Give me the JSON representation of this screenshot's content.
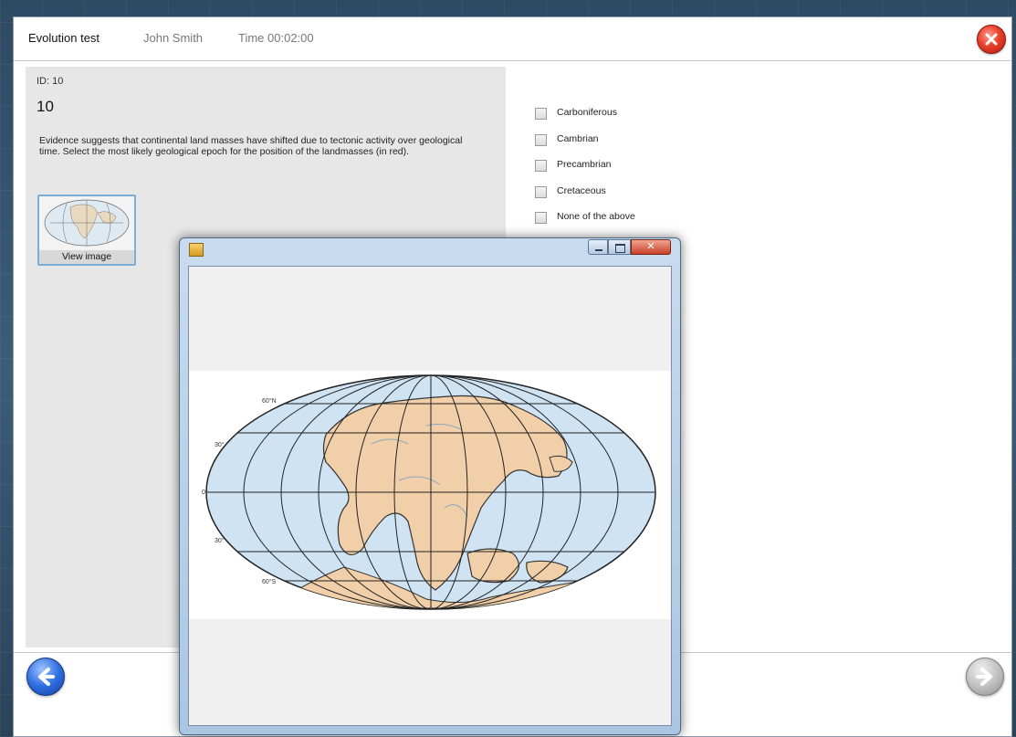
{
  "header": {
    "title": "Evolution  test",
    "user": "John Smith",
    "time": "Time 00:02:00"
  },
  "question": {
    "id_label": "ID: 10",
    "number": "10",
    "text": "Evidence suggests that continental land masses have shifted due to tectonic activity over geological time. Select the most likely geological epoch for the position of the landmasses (in red).",
    "thumbnail_label": "View image"
  },
  "options": [
    {
      "label": "Carboniferous",
      "checked": false
    },
    {
      "label": "Cambrian",
      "checked": false
    },
    {
      "label": "Precambrian",
      "checked": false
    },
    {
      "label": "Cretaceous",
      "checked": false
    },
    {
      "label": "None of the above",
      "checked": false
    }
  ],
  "map": {
    "latitude_labels": [
      "60°N",
      "30°",
      "0°",
      "30°",
      "60°S"
    ]
  },
  "icons": {
    "close": "close-circle-icon",
    "back": "arrow-left-circle-icon",
    "next": "arrow-right-circle-icon",
    "popup_app": "application-icon"
  },
  "colors": {
    "ocean": "#cfe3f3",
    "land": "#f1cfa8",
    "close": "#e8402a",
    "back": "#2f6fe0",
    "next_disabled": "#bdbdbd"
  }
}
